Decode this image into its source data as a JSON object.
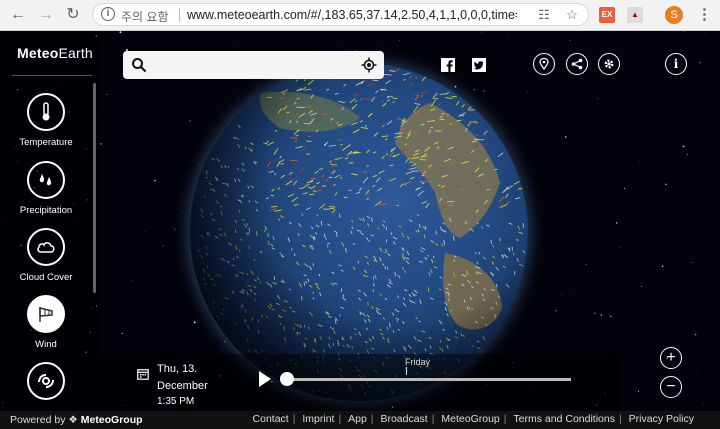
{
  "browser": {
    "security_text": "주의 요함",
    "url": "www.meteoearth.com/#/,183.65,37.14,2.50,4,1,1,0,0,0,time=1544",
    "profile_initial": "S",
    "ext1": "EX"
  },
  "app": {
    "logo_bold": "Meteo",
    "logo_thin": "Earth",
    "search_placeholder": "",
    "layers": [
      {
        "label": "Temperature"
      },
      {
        "label": "Precipitation"
      },
      {
        "label": "Cloud Cover"
      },
      {
        "label": "Wind"
      }
    ],
    "timeline": {
      "day_line": "Thu, 13.",
      "month_line": "December",
      "time_line": "1:35 PM",
      "next_day": "Friday",
      "progress": 0.0
    },
    "zoom_in": "+",
    "zoom_out": "−"
  },
  "footer": {
    "powered_prefix": "Powered by",
    "powered_brand": "MeteoGroup",
    "links": [
      "Contact",
      "Imprint",
      "App",
      "Broadcast",
      "MeteoGroup",
      "Terms and Conditions",
      "Privacy Policy"
    ]
  }
}
